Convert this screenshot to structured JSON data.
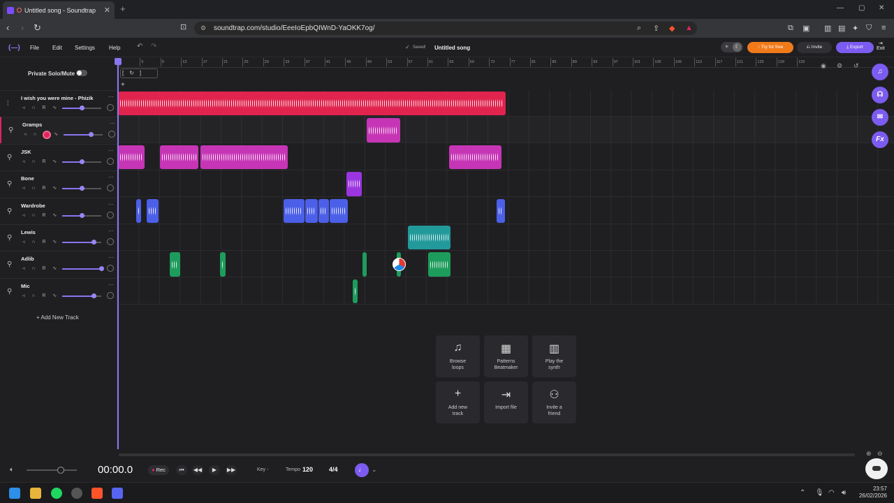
{
  "browser": {
    "tab_title": "Untitled song - Soundtrap",
    "new_tab": "+",
    "url": "soundtrap.com/studio/EeeIoEpbQIWnD-YaOKK7og/"
  },
  "app": {
    "logo": "(—)",
    "menu": [
      "File",
      "Edit",
      "Settings",
      "Help"
    ],
    "saved_status": "Saved!",
    "song_title": "Untitled song",
    "try_free": "Try for free",
    "invite": "Invite",
    "export": "Export",
    "exit": "Exit"
  },
  "left_panel": {
    "private_solo_mute": "Private Solo/Mute",
    "add_new_track": "+ Add New Track",
    "tracks": [
      {
        "name": "I wish you were mine - Phizik",
        "volume": 0.5
      },
      {
        "name": "Gramps",
        "volume": 0.7
      },
      {
        "name": "JSK",
        "volume": 0.5
      },
      {
        "name": "Bone",
        "volume": 0.5
      },
      {
        "name": "Wardrobe",
        "volume": 0.5
      },
      {
        "name": "Lewis",
        "volume": 0.8
      },
      {
        "name": "Adlib",
        "volume": 1.0
      },
      {
        "name": "Mic",
        "volume": 0.8
      }
    ]
  },
  "ruler": {
    "bars": [
      "1",
      "5",
      "9",
      "13",
      "17",
      "21",
      "25",
      "29",
      "33",
      "37",
      "41",
      "45",
      "49",
      "53",
      "57",
      "61",
      "65",
      "69",
      "73",
      "77",
      "81",
      "85",
      "89",
      "93",
      "97",
      "101",
      "105",
      "109",
      "113",
      "117",
      "121",
      "125",
      "129",
      "133"
    ]
  },
  "cards": [
    {
      "label": "Browse\nloops",
      "icon": "music-note-icon"
    },
    {
      "label": "Patterns\nBeatmaker",
      "icon": "grid-icon"
    },
    {
      "label": "Play the\nsynth",
      "icon": "piano-icon"
    },
    {
      "label": "Add new\ntrack",
      "icon": "plus-icon"
    },
    {
      "label": "Import file",
      "icon": "import-icon"
    },
    {
      "label": "Invite a\nfriend",
      "icon": "invite-user-icon"
    }
  ],
  "transport": {
    "time": "00:00.0",
    "rec": "Rec",
    "key_label": "Key -",
    "tempo_label": "Tempo",
    "tempo_value": "120",
    "time_signature": "4/4"
  },
  "taskbar": {
    "time": "23:57",
    "date": "26/02/2026"
  },
  "colors": {
    "accent": "#7c5cf0",
    "red_clip": "#e0244e",
    "magenta_clip": "#c635b5",
    "purple_clip": "#9b35e0",
    "blue_clip": "#4c5fe8",
    "teal_clip": "#22999b",
    "green_clip": "#1e9c5c"
  }
}
